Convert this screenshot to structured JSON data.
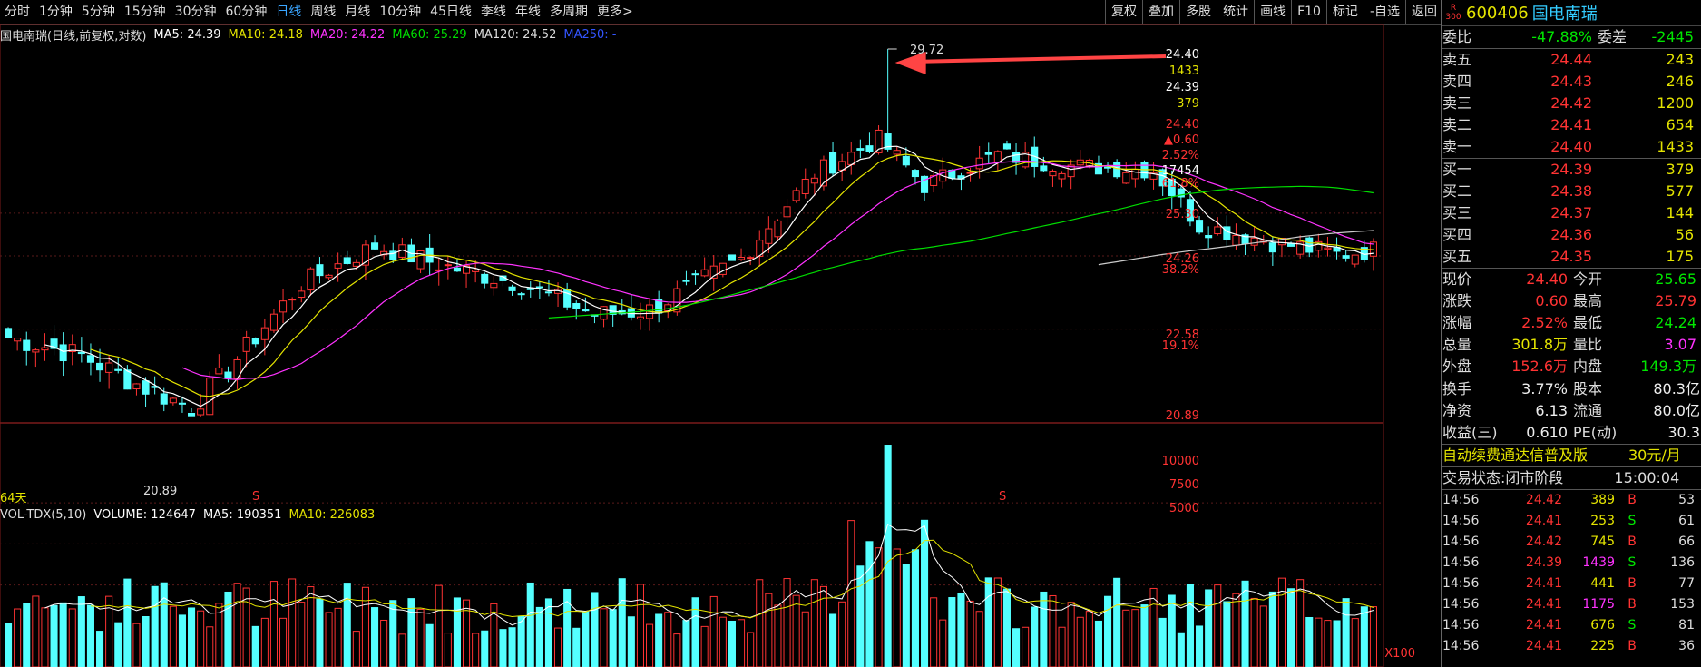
{
  "toolbar": {
    "left_tabs": [
      "分时",
      "1分钟",
      "5分钟",
      "15分钟",
      "30分钟",
      "60分钟",
      "日线",
      "周线",
      "月线",
      "10分钟",
      "45日线",
      "季线",
      "年线",
      "多周期",
      "更多>"
    ],
    "active_tab": "日线",
    "right_tabs": [
      "复权",
      "叠加",
      "多股",
      "统计",
      "画线",
      "F10",
      "标记",
      "-自选",
      "返回"
    ]
  },
  "chart_header": {
    "title": "国电南瑞(日线,前复权,对数)",
    "ma5": "MA5: 24.39",
    "ma10": "MA10: 24.18",
    "ma20": "MA20: 24.22",
    "ma60": "MA60: 25.29",
    "ma120": "MA120: 24.52",
    "ma250": "MA250: -"
  },
  "volume_header": {
    "title": "VOL-TDX(5,10)",
    "volume": "VOLUME: 124647",
    "ma5": "MA5: 190351",
    "ma10": "MA10: 226083"
  },
  "annotations": {
    "peak_label": "29.72",
    "low_label": "20.89",
    "days_label": "64天",
    "signal_1": "S",
    "signal_2": "S",
    "vol_unit": "X100"
  },
  "price_axis": [
    {
      "text": "24.40",
      "color": "#ffffff"
    },
    {
      "text": "1433",
      "color": "#e4e400"
    },
    {
      "text": "24.39",
      "color": "#ffffff"
    },
    {
      "text": "379",
      "color": "#e4e400"
    },
    {
      "text": "24.40",
      "color": "#ff3333"
    },
    {
      "text": "▲0.60",
      "color": "#ff3333"
    },
    {
      "text": "2.52%",
      "color": "#ff3333"
    },
    {
      "text": "17454",
      "color": "#ffffff"
    },
    {
      "text": "61.8%",
      "color": "#ff3333"
    },
    {
      "text": "25.30",
      "color": "#ff3333"
    },
    {
      "text": "24.26",
      "color": "#ff3333"
    },
    {
      "text": "38.2%",
      "color": "#ff3333"
    },
    {
      "text": "22.58",
      "color": "#ff3333"
    },
    {
      "text": "19.1%",
      "color": "#ff3333"
    },
    {
      "text": "20.89",
      "color": "#ff3333"
    }
  ],
  "vol_axis": [
    "10000",
    "7500",
    "5000"
  ],
  "stock": {
    "badge_top": "R",
    "badge_bottom": "300",
    "code": "600406",
    "name": "国电南瑞"
  },
  "weibi": {
    "label": "委比",
    "value": "-47.88%",
    "label2": "委差",
    "value2": "-2445"
  },
  "sells": [
    {
      "label": "卖五",
      "price": "24.44",
      "vol": "243"
    },
    {
      "label": "卖四",
      "price": "24.43",
      "vol": "246"
    },
    {
      "label": "卖三",
      "price": "24.42",
      "vol": "1200"
    },
    {
      "label": "卖二",
      "price": "24.41",
      "vol": "654"
    },
    {
      "label": "卖一",
      "price": "24.40",
      "vol": "1433"
    }
  ],
  "buys": [
    {
      "label": "买一",
      "price": "24.39",
      "vol": "379"
    },
    {
      "label": "买二",
      "price": "24.38",
      "vol": "577"
    },
    {
      "label": "买三",
      "price": "24.37",
      "vol": "144"
    },
    {
      "label": "买四",
      "price": "24.36",
      "vol": "56"
    },
    {
      "label": "买五",
      "price": "24.35",
      "vol": "175"
    }
  ],
  "quote": [
    {
      "l1": "现价",
      "v1": "24.40",
      "c1": "red",
      "l2": "今开",
      "v2": "25.65",
      "c2": "grn"
    },
    {
      "l1": "涨跌",
      "v1": "0.60",
      "c1": "red",
      "l2": "最高",
      "v2": "25.79",
      "c2": "red"
    },
    {
      "l1": "涨幅",
      "v1": "2.52%",
      "c1": "red",
      "l2": "最低",
      "v2": "24.24",
      "c2": "grn"
    },
    {
      "l1": "总量",
      "v1": "301.8万",
      "c1": "yel",
      "l2": "量比",
      "v2": "3.07",
      "c2": "mag"
    },
    {
      "l1": "外盘",
      "v1": "152.6万",
      "c1": "red",
      "l2": "内盘",
      "v2": "149.3万",
      "c2": "grn"
    }
  ],
  "fund": [
    {
      "l1": "换手",
      "v1": "3.77%",
      "l2": "股本",
      "v2": "80.3亿"
    },
    {
      "l1": "净资",
      "v1": "6.13",
      "l2": "流通",
      "v2": "80.0亿"
    },
    {
      "l1": "收益(三)",
      "v1": "0.610",
      "l2": "PE(动)",
      "v2": "30.3"
    }
  ],
  "promo": {
    "text": "自动续费通达信普及版",
    "price": "30元/月"
  },
  "status": {
    "label": "交易状态:",
    "value": "闭市阶段",
    "time": "15:00:04"
  },
  "ticks": [
    {
      "time": "14:56",
      "price": "24.42",
      "vol": "389",
      "side": "B",
      "extra": "53"
    },
    {
      "time": "14:56",
      "price": "24.41",
      "vol": "253",
      "side": "S",
      "extra": "61"
    },
    {
      "time": "14:56",
      "price": "24.42",
      "vol": "745",
      "side": "B",
      "extra": "66"
    },
    {
      "time": "14:56",
      "price": "24.39",
      "vol": "1439",
      "side": "S",
      "extra": "136"
    },
    {
      "time": "14:56",
      "price": "24.41",
      "vol": "441",
      "side": "B",
      "extra": "77"
    },
    {
      "time": "14:56",
      "price": "24.41",
      "vol": "1175",
      "side": "B",
      "extra": "153"
    },
    {
      "time": "14:56",
      "price": "24.41",
      "vol": "676",
      "side": "S",
      "extra": "81"
    },
    {
      "time": "14:56",
      "price": "24.41",
      "vol": "225",
      "side": "B",
      "extra": "36"
    }
  ],
  "chart_data": {
    "type": "candlestick",
    "price_scale": {
      "min": 20.89,
      "max": 29.72,
      "log": true
    },
    "ma_colors": {
      "ma5": "#ffffff",
      "ma10": "#e4e400",
      "ma20": "#ff33ff",
      "ma60": "#00dd00",
      "ma120": "#cccccc",
      "ma250": "#3355ff"
    },
    "up_color": "#ff3333",
    "down_color": "#54ffff",
    "volume_scale": {
      "max": 12000
    }
  }
}
